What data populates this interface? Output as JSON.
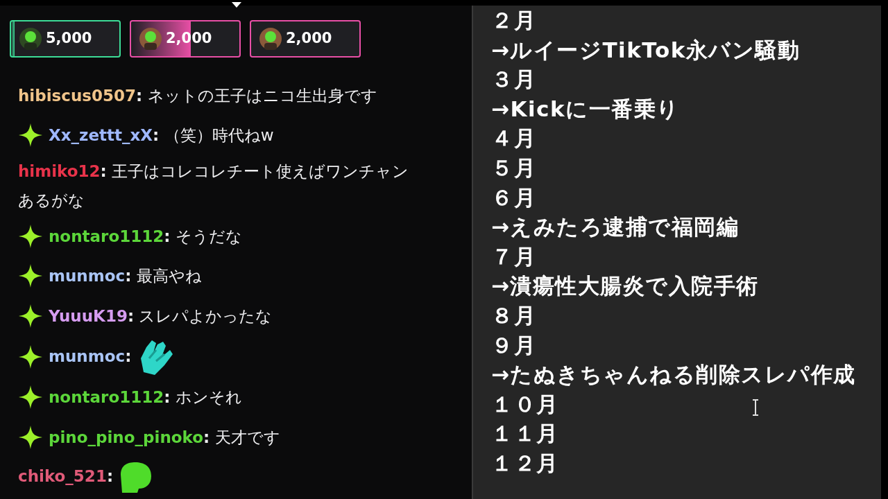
{
  "predictions": [
    {
      "amount": "5,000",
      "color": "#3ddc97",
      "level": 0.03
    },
    {
      "amount": "2,000",
      "color": "#e84fa6",
      "level": 0.55
    },
    {
      "amount": "2,000",
      "color": "#e84fa6"
    }
  ],
  "chat": [
    {
      "badge": false,
      "user": "hibiscus0507",
      "color": "#f0c48a",
      "kind": "text",
      "text": "ネットの王子はニコ生出身です",
      "sep": ":"
    },
    {
      "badge": true,
      "user": "Xx_zettt_xX",
      "color": "#9fb8ff",
      "kind": "text",
      "text": "（笑）時代ねw",
      "sep": ":"
    },
    {
      "badge": false,
      "user": "himiko12",
      "color": "#e8334a",
      "kind": "text",
      "text": "王子はコレコレチート使えばワンチャン",
      "wrap": "あるがな",
      "sep": ":"
    },
    {
      "badge": true,
      "user": "nontaro1112",
      "color": "#5cd63a",
      "kind": "text",
      "text": "そうだな",
      "sep": ":"
    },
    {
      "badge": true,
      "user": "munmoc",
      "color": "#a9c4f5",
      "kind": "text",
      "text": "最高やね",
      "sep": ":"
    },
    {
      "badge": true,
      "user": "YuuuK19",
      "color": "#d59cf0",
      "kind": "text",
      "text": "スレパよかったな",
      "sep": ":"
    },
    {
      "badge": true,
      "user": "munmoc",
      "color": "#a9c4f5",
      "kind": "hands",
      "sep": ":"
    },
    {
      "badge": true,
      "user": "nontaro1112",
      "color": "#5cd63a",
      "kind": "text",
      "text": "ホンそれ",
      "sep": ":"
    },
    {
      "badge": true,
      "user": "pino_pino_pinoko",
      "color": "#5cd63a",
      "kind": "text",
      "text": "天才です",
      "sep": ":"
    },
    {
      "badge": false,
      "user": "chiko_521",
      "color": "#e05a78",
      "kind": "frog",
      "sep": ":"
    }
  ],
  "notes": [
    "２月",
    "→ルイージTikTok永バン騒動",
    "３月",
    "→Kickに一番乗り",
    "４月",
    "５月",
    "６月",
    "→えみたろ逮捕で福岡編",
    "７月",
    "→潰瘍性大腸炎で入院手術",
    "８月",
    "９月",
    "→たぬきちゃんねる削除スレパ作成",
    "１０月",
    "１１月",
    "１２月"
  ]
}
